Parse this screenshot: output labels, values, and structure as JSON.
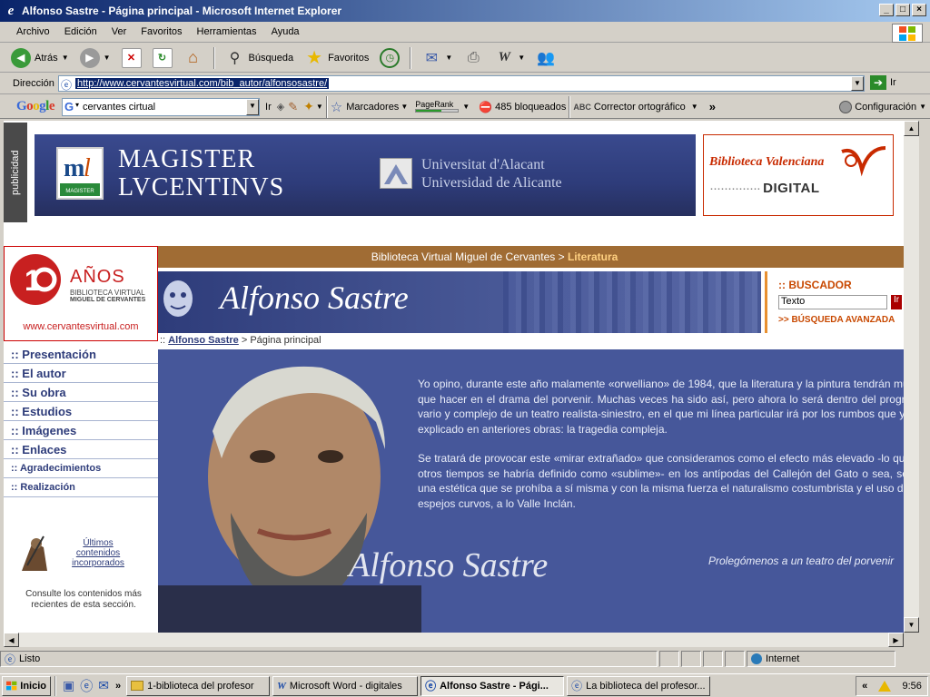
{
  "window": {
    "title": "Alfonso Sastre - Página principal - Microsoft Internet Explorer",
    "controls": [
      "_",
      "□",
      "×"
    ]
  },
  "menu": [
    "Archivo",
    "Edición",
    "Ver",
    "Favoritos",
    "Herramientas",
    "Ayuda"
  ],
  "toolbar": {
    "back_label": "Atrás",
    "search_label": "Búsqueda",
    "favorites_label": "Favoritos"
  },
  "address": {
    "label": "Dirección",
    "url": "http://www.cervantesvirtual.com/bib_autor/alfonsosastre/",
    "go_label": "Ir"
  },
  "googlebar": {
    "logo": "Google",
    "search_value": "cervantes cirtual",
    "go_label": "Ir",
    "bookmarks_label": "Marcadores",
    "pagerank_label": "PageRank",
    "blocked_label": "485 bloqueados",
    "spell_label": "Corrector ortográfico",
    "more_label": "»",
    "settings_label": "Configuración"
  },
  "ad": {
    "tab_label": "publicidad",
    "banner_title_1": "MAGISTER",
    "banner_title_2": "LVCENTINVS",
    "logo_text": "MAGISTER LVCENTINVS",
    "ua_line_1": "Universitat d'Alacant",
    "ua_line_2": "Universidad de Alicante",
    "bvd_line_1": "Biblioteca Valenciana",
    "bvd_line_2": "DIGITAL"
  },
  "site": {
    "anos_label": "AÑOS",
    "anos_sub_1": "BIBLIOTECA VIRTUAL",
    "anos_sub_2": "MIGUEL DE CERVANTES",
    "site_url": "www.cervantesvirtual.com",
    "breadcrumb_main": "Biblioteca Virtual Miguel de Cervantes >",
    "breadcrumb_section": "Literatura",
    "author_name": "Alfonso Sastre",
    "page_crumb_sep": ":: ",
    "page_crumb_link": "Alfonso Sastre",
    "page_crumb_rest": " > Página principal"
  },
  "nav": [
    ":: Presentación",
    ":: El autor",
    ":: Su obra",
    ":: Estudios",
    ":: Imágenes",
    ":: Enlaces",
    ":: Agradecimientos",
    ":: Realización"
  ],
  "novedades": {
    "link_1": "Últimos",
    "link_2": "contenidos",
    "link_3": "incorporados",
    "desc_1": "Consulte los contenidos más",
    "desc_2": "recientes de esta sección."
  },
  "buscador": {
    "title": ":: BUSCADOR",
    "input_value": "Texto",
    "go_label": "Ir",
    "advanced_label": ">> BÚSQUEDA AVANZADA"
  },
  "quote": {
    "p1": "Yo opino, durante este año malamente «orwelliano» de 1984, que la literatura y la pintura tendrán mucho que hacer en el drama del porvenir. Muchas veces ha sido así, pero ahora lo será dentro del programa vario y complejo de un teatro realista-siniestro, en el que mi línea particular irá por los rumbos que ya he explicado en anteriores obras: la tragedia compleja.",
    "p2": "Se tratará de provocar este «mirar extrañado» que consideramos como el efecto más elevado -lo que en otros tiempos se habría definido como «sublime»- en los antípodas del Callejón del Gato o sea, según una estética que se prohíba a sí misma y con la misma fuerza el naturalismo costumbrista y el uso de los espejos curvos, a lo Valle Inclán.",
    "source": "Prolegómenos a un teatro del porvenir",
    "signature": "Alfonso Sastre"
  },
  "status": {
    "text": "Listo",
    "zone": "Internet"
  },
  "taskbar": {
    "start_label": "Inicio",
    "quick_more": "»",
    "items": [
      "1-biblioteca del profesor",
      "Microsoft Word - digitales",
      "Alfonso Sastre - Pági...",
      "La biblioteca del profesor..."
    ],
    "tray_more": "«",
    "clock": "9:56"
  },
  "colors": {
    "site_blue": "#46579a",
    "site_brown": "#a06c34",
    "accent_orange": "#c84800",
    "bvd_red": "#c82a00"
  }
}
